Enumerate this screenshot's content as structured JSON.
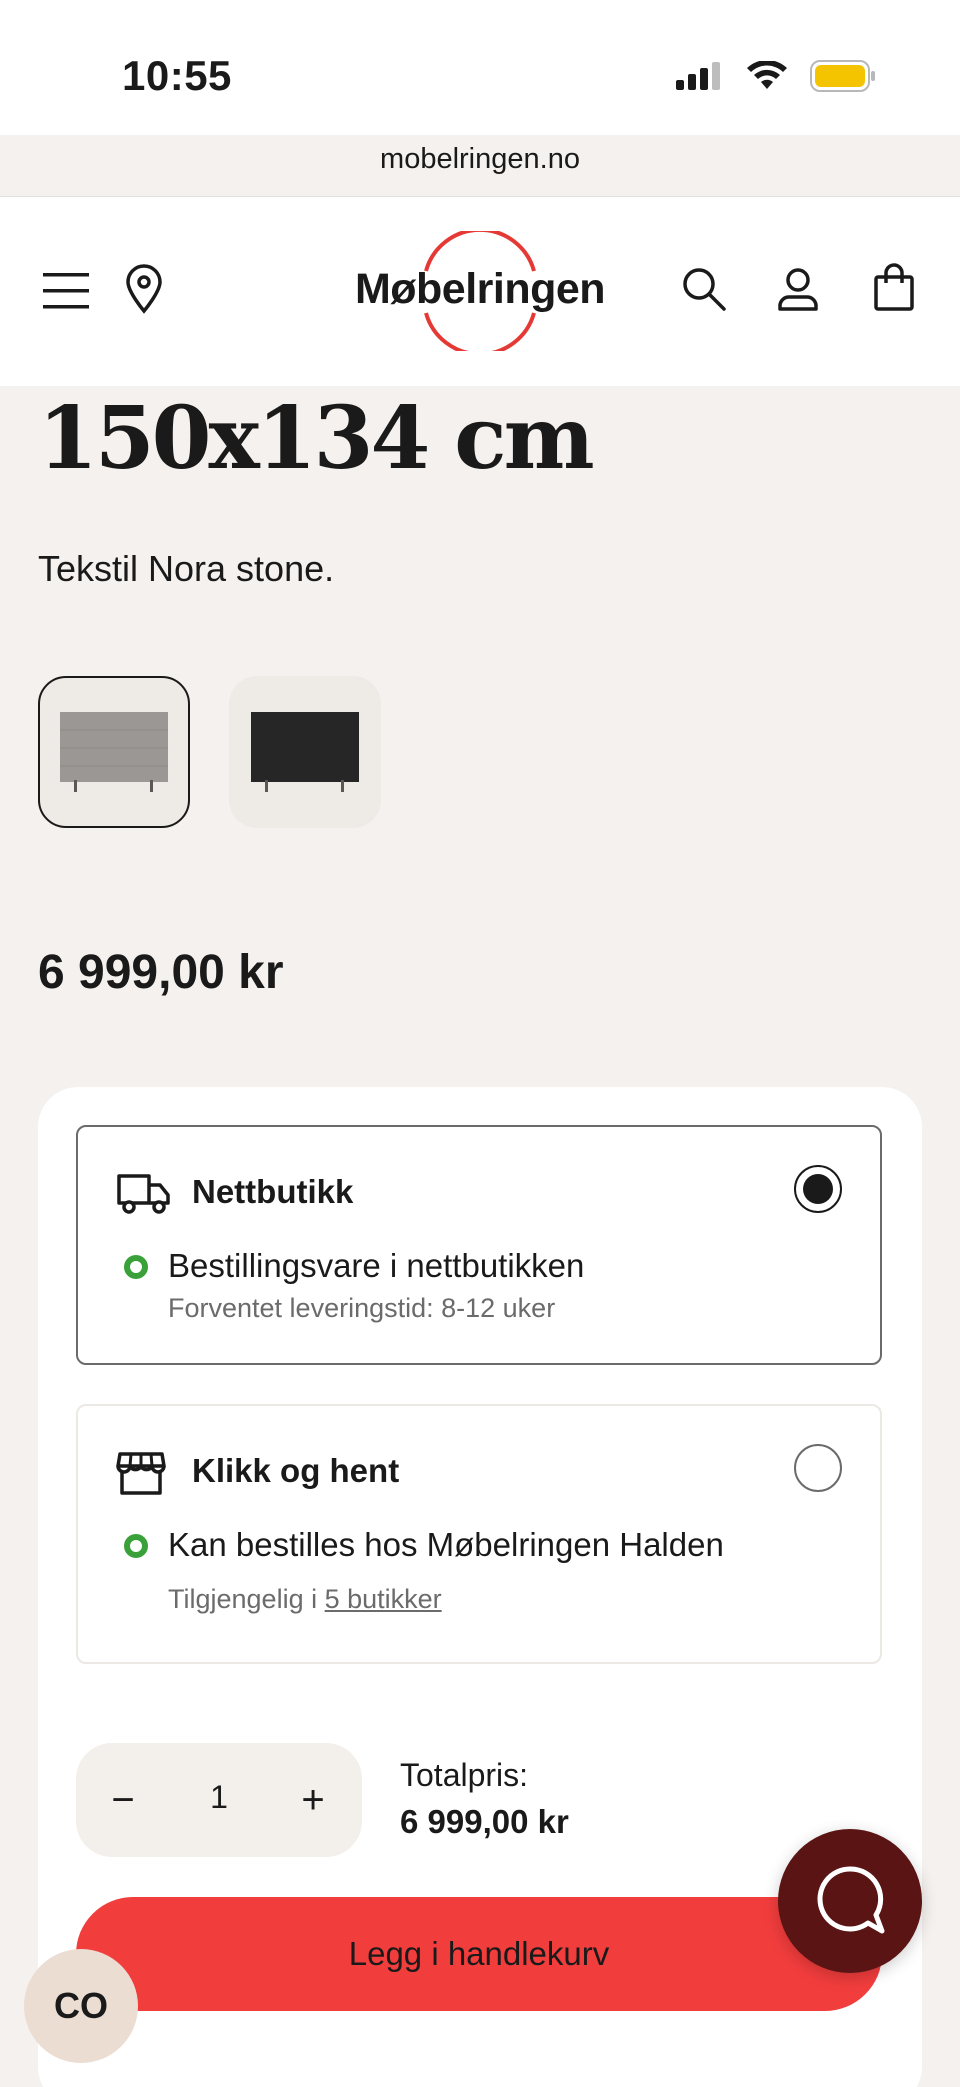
{
  "status_bar": {
    "time": "10:55",
    "url": "mobelringen.no"
  },
  "header": {
    "logo_text": "Møbelringen",
    "icons": [
      "menu-icon",
      "location-pin-icon",
      "search-icon",
      "account-icon",
      "shopping-bag-icon"
    ]
  },
  "product": {
    "title": "150x134 cm",
    "description": "Tekstil Nora stone.",
    "swatches": [
      {
        "name": "Nora stone",
        "color": "#9b9794",
        "selected": true
      },
      {
        "name": "Svart",
        "color": "#262626",
        "selected": false
      }
    ],
    "price": "6 999,00 kr"
  },
  "delivery": {
    "options": [
      {
        "title": "Nettbutikk",
        "icon": "truck-icon",
        "status": "Bestillingsvare i nettbutikken",
        "sub": "Forventet leveringstid: 8-12 uker",
        "selected": true
      },
      {
        "title": "Klikk og hent",
        "icon": "store-icon",
        "status": "Kan bestilles hos Møbelringen Halden",
        "sub_prefix": "Tilgjengelig i",
        "sub_link": "5 butikker",
        "selected": false
      }
    ]
  },
  "quantity": {
    "value": "1",
    "minus": "−",
    "plus": "+"
  },
  "total": {
    "label": "Totalpris:",
    "value": "6 999,00 kr"
  },
  "cart_button": {
    "label": "Legg i handlekurv"
  },
  "floating": {
    "co_label": "CO"
  },
  "colors": {
    "accent_red": "#f23d3d",
    "chat_bg": "#5a1414",
    "stock_green": "#3aa13a",
    "page_bg": "#f5f1ee"
  }
}
